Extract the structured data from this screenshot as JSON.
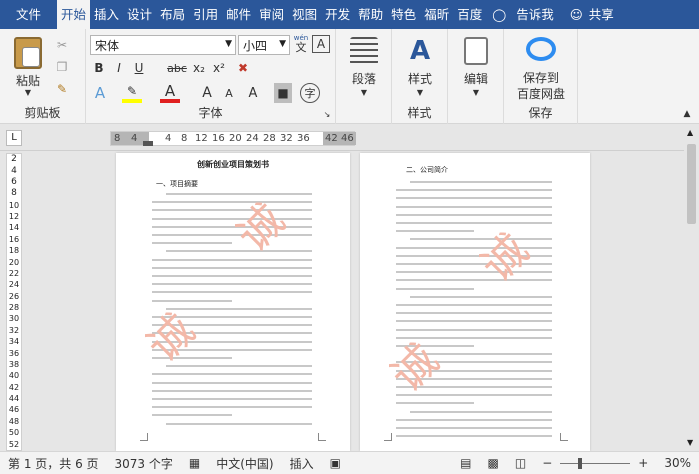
{
  "tabs": [
    "文件",
    "开始",
    "插入",
    "设计",
    "布局",
    "引用",
    "邮件",
    "审阅",
    "视图",
    "开发",
    "帮助",
    "特色",
    "福昕",
    "百度"
  ],
  "tell_me": "告诉我",
  "share": "共享",
  "ribbon": {
    "clipboard": {
      "paste": "粘贴",
      "label": "剪贴板"
    },
    "font": {
      "name": "宋体",
      "size": "小四",
      "label": "字体",
      "wen_top": "wén",
      "wen": "文",
      "A": "A"
    },
    "paragraph": {
      "label": "段落"
    },
    "styles": {
      "button": "样式",
      "label": "样式"
    },
    "edit": {
      "button": "编辑"
    },
    "save": {
      "button_l1": "保存到",
      "button_l2": "百度网盘",
      "label": "保存"
    }
  },
  "font_buttons": [
    "B",
    "I",
    "U",
    "abc",
    "x₂",
    "x²",
    "A",
    "A",
    "A",
    "A",
    "A"
  ],
  "ruler_ticks": [
    "8",
    "4",
    "",
    "4",
    "8",
    "12",
    "16",
    "20",
    "24",
    "28",
    "32",
    "36",
    "",
    "42",
    "46"
  ],
  "vruler_ticks": [
    "2",
    "4",
    "6",
    "8",
    "10",
    "12",
    "14",
    "16",
    "18",
    "20",
    "22",
    "24",
    "26",
    "28",
    "30",
    "32",
    "34",
    "36",
    "38",
    "40",
    "42",
    "44",
    "46",
    "48",
    "50",
    "52"
  ],
  "page1": {
    "title": "创新创业项目策划书",
    "heading": "一、项目摘要"
  },
  "page2": {
    "heading": "二、公司简介"
  },
  "watermark": "诚",
  "status": {
    "page": "第 1 页，共 6 页",
    "words": "3073 个字",
    "lang": "中文(中国)",
    "mode": "插入",
    "zoom": "30%"
  }
}
